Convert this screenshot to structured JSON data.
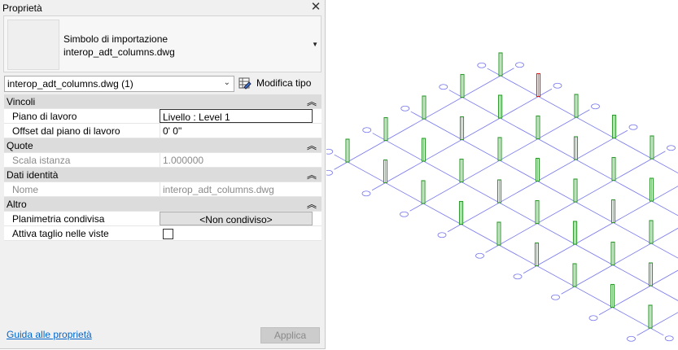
{
  "panel": {
    "title": "Proprietà",
    "type_name_line1": "Simbolo di importazione",
    "type_name_line2": "interop_adt_columns.dwg",
    "selector_value": "interop_adt_columns.dwg (1)",
    "edit_type_label": "Modifica tipo",
    "help_link": "Guida alle proprietà",
    "apply_button": "Applica"
  },
  "sections": [
    {
      "title": "Vincoli",
      "collapse_icon": "double-chevron-up-icon"
    },
    {
      "title": "Quote",
      "collapse_icon": "double-chevron-up-icon"
    },
    {
      "title": "Dati identità",
      "collapse_icon": "double-chevron-up-icon"
    },
    {
      "title": "Altro",
      "collapse_icon": "double-chevron-up-icon"
    }
  ],
  "props": {
    "work_plane": {
      "name": "Piano di lavoro",
      "value": "Livello : Level 1"
    },
    "work_plane_offset": {
      "name": "Offset dal piano di lavoro",
      "value": "0'  0\""
    },
    "instance_scale": {
      "name": "Scala istanza",
      "value": "1.000000"
    },
    "identity_name": {
      "name": "Nome",
      "value": "interop_adt_columns.dwg"
    },
    "shared_site": {
      "name": "Planimetria condivisa",
      "value": "<Non condiviso>"
    },
    "enable_cut": {
      "name": "Attiva taglio nelle viste",
      "checked": false
    }
  },
  "view": {
    "grid_color": "#7777ee",
    "column_color": "#2e9a2e",
    "selected_column_color": "#e02020"
  }
}
